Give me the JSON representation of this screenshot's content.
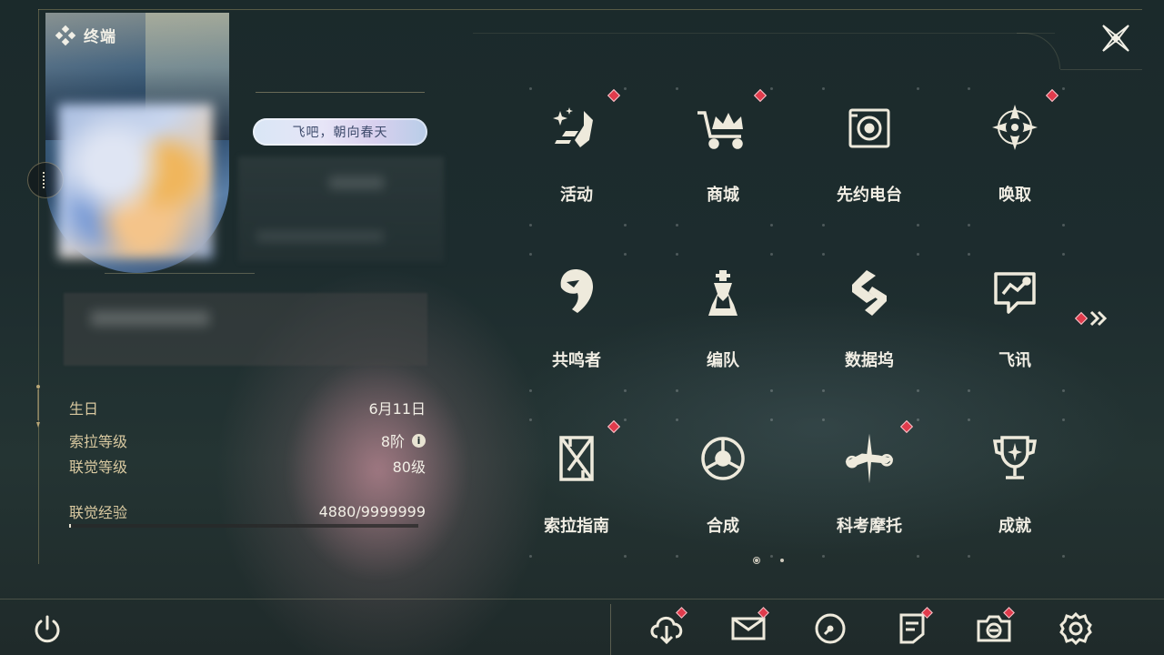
{
  "header": {
    "title": "终端",
    "close_icon": "close-x-icon"
  },
  "profile": {
    "tag_text": "飞吧，朝向春天",
    "stats": [
      {
        "key": "生日",
        "value": "6月11日"
      },
      {
        "key": "索拉等级",
        "value": "8阶",
        "has_info": true
      },
      {
        "key": "联觉等级",
        "value": "80级"
      }
    ],
    "exp": {
      "label": "联觉经验",
      "value": "4880/9999999",
      "progress": 0.0005
    }
  },
  "menu": {
    "items": [
      {
        "label": "活动",
        "icon": "sparkle-icon",
        "badge": true
      },
      {
        "label": "商城",
        "icon": "shop-cart-icon",
        "badge": true
      },
      {
        "label": "先约电台",
        "icon": "radio-icon",
        "badge": false
      },
      {
        "label": "唤取",
        "icon": "compass-icon",
        "badge": true
      },
      {
        "label": "共鸣者",
        "icon": "character-icon",
        "badge": false
      },
      {
        "label": "编队",
        "icon": "chess-icon",
        "badge": false
      },
      {
        "label": "数据坞",
        "icon": "data-dock-icon",
        "badge": false
      },
      {
        "label": "飞讯",
        "icon": "message-icon",
        "badge": false
      },
      {
        "label": "索拉指南",
        "icon": "guide-icon",
        "badge": true
      },
      {
        "label": "合成",
        "icon": "synthesis-icon",
        "badge": false
      },
      {
        "label": "科考摩托",
        "icon": "motorcycle-icon",
        "badge": true
      },
      {
        "label": "成就",
        "icon": "trophy-icon",
        "badge": false
      }
    ],
    "next_page_badge": true,
    "pager": {
      "pages": 2,
      "current": 1
    }
  },
  "dock": [
    {
      "icon": "download-icon",
      "badge": true
    },
    {
      "icon": "mail-icon",
      "badge": true
    },
    {
      "icon": "clock-icon",
      "badge": false
    },
    {
      "icon": "notes-icon",
      "badge": true
    },
    {
      "icon": "camera-icon",
      "badge": true
    },
    {
      "icon": "settings-icon",
      "badge": false
    }
  ],
  "colors": {
    "accent_gold": "#d9c9a0",
    "badge_red": "#e13b4c",
    "text": "#f1eee4",
    "bg": "#1d2c2e"
  }
}
